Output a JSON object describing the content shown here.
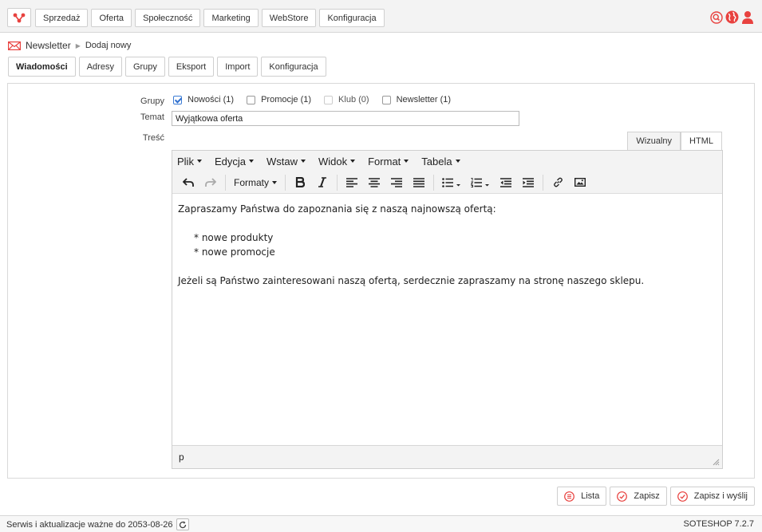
{
  "topnav": {
    "items": [
      "Sprzedaż",
      "Oferta",
      "Społeczność",
      "Marketing",
      "WebStore",
      "Konfiguracja"
    ]
  },
  "top_icons": [
    "search-icon",
    "globe-icon",
    "user-icon"
  ],
  "breadcrumb": {
    "module": "Newsletter",
    "current": "Dodaj nowy"
  },
  "tabs": [
    "Wiadomości",
    "Adresy",
    "Grupy",
    "Eksport",
    "Import",
    "Konfiguracja"
  ],
  "form": {
    "groups_label": "Grupy",
    "groups": [
      {
        "label": "Nowości (1)",
        "checked": true,
        "disabled": false
      },
      {
        "label": "Promocje (1)",
        "checked": false,
        "disabled": false
      },
      {
        "label": "Klub (0)",
        "checked": false,
        "disabled": true
      },
      {
        "label": "Newsletter (1)",
        "checked": false,
        "disabled": false
      }
    ],
    "subject_label": "Temat",
    "subject_value": "Wyjątkowa oferta",
    "body_label": "Treść"
  },
  "editor": {
    "mode_tabs": [
      "Wizualny",
      "HTML"
    ],
    "active_mode": "HTML",
    "menu": [
      "Plik",
      "Edycja",
      "Wstaw",
      "Widok",
      "Format",
      "Tabela"
    ],
    "formats_label": "Formaty",
    "content": {
      "intro": "Zapraszamy Państwa do zapoznania się z naszą najnowszą ofertą:",
      "bullets": [
        "* nowe produkty",
        "* nowe promocje"
      ],
      "outro": "Jeżeli są Państwo zainteresowani naszą ofertą, serdecznie zapraszamy na stronę naszego sklepu."
    },
    "status_path": "p"
  },
  "actions": {
    "list": "Lista",
    "save": "Zapisz",
    "save_send": "Zapisz i wyślij"
  },
  "footer": {
    "service_text": "Serwis i aktualizacje ważne do 2053-08-26",
    "version": "SOTESHOP 7.2.7"
  },
  "colors": {
    "accent": "#e8423f",
    "checkbox": "#2f6fce"
  }
}
